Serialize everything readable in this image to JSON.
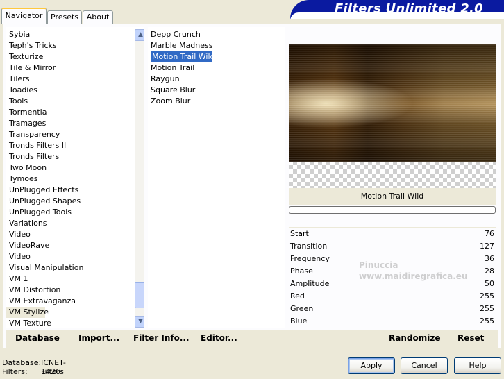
{
  "window": {
    "title": "Filters Unlimited 2.0"
  },
  "tabs": [
    {
      "label": "Navigator",
      "active": true
    },
    {
      "label": "Presets",
      "active": false
    },
    {
      "label": "About",
      "active": false
    }
  ],
  "categories": {
    "items": [
      "Sybia",
      "Teph's Tricks",
      "Texturize",
      "Tile & Mirror",
      "Tilers",
      "Toadies",
      "Tools",
      "Tormentia",
      "Tramages",
      "Transparency",
      "Tronds Filters II",
      "Tronds Filters",
      "Two Moon",
      "Tymoes",
      "UnPlugged Effects",
      "UnPlugged Shapes",
      "UnPlugged Tools",
      "Variations",
      "Video",
      "VideoRave",
      "Video",
      "Visual Manipulation",
      "VM 1",
      "VM Distortion",
      "VM Extravaganza",
      "VM Stylize",
      "VM Texture"
    ],
    "selected": "VM Stylize"
  },
  "filters": {
    "items": [
      "Depp Crunch",
      "Marble Madness",
      "Motion Trail Wild",
      "Motion Trail",
      "Raygun",
      "Square Blur",
      "Zoom Blur"
    ],
    "selected": "Motion Trail Wild"
  },
  "preview": {
    "caption": "Motion Trail Wild"
  },
  "parameters": [
    {
      "label": "Start",
      "value": "76"
    },
    {
      "label": "Transition",
      "value": "127"
    },
    {
      "label": "Frequency",
      "value": "36"
    },
    {
      "label": "Phase",
      "value": "28"
    },
    {
      "label": "Amplitude",
      "value": "50"
    },
    {
      "label": "Red",
      "value": "255"
    },
    {
      "label": "Green",
      "value": "255"
    },
    {
      "label": "Blue",
      "value": "255"
    }
  ],
  "bottom_buttons": {
    "database": "Database",
    "import": "Import...",
    "filter_info": "Filter Info...",
    "editor": "Editor...",
    "randomize": "Randomize",
    "reset": "Reset"
  },
  "status": {
    "database_label": "Database:",
    "database_value": "ICNET-Filters",
    "filters_label": "Filters:",
    "filters_value": "1426"
  },
  "dialog_buttons": {
    "apply": "Apply",
    "cancel": "Cancel",
    "help": "Help"
  },
  "watermark": {
    "line1": "Pinuccia",
    "line2": "www.maidiregrafica.eu"
  },
  "colors": {
    "selection": "#316ac5",
    "banner": "#0a1aa0",
    "face": "#ece9d8"
  }
}
